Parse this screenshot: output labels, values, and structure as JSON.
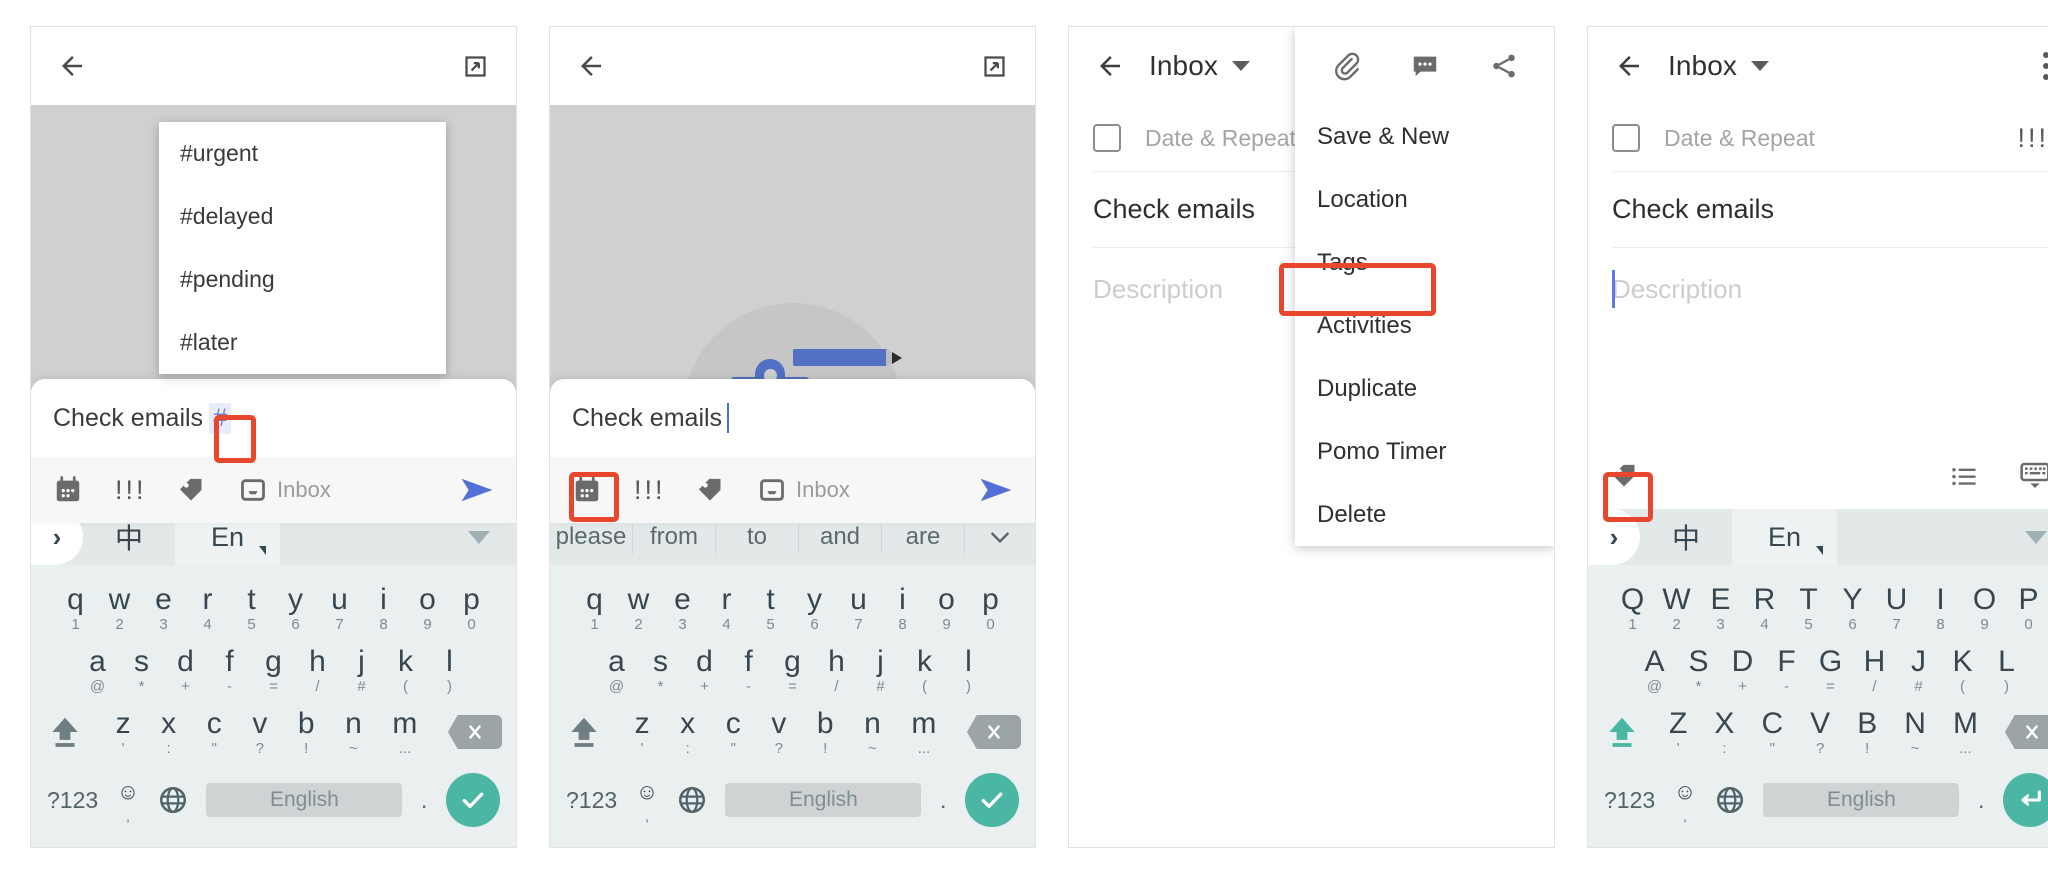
{
  "panels": [
    {
      "id": "panel-1-tag-autocomplete",
      "appbar": {
        "back_icon": "arrow-left-icon",
        "expand_icon": "open-in-new-icon"
      },
      "tag_suggestions": [
        "#urgent",
        "#delayed",
        "#pending",
        "#later"
      ],
      "compose": {
        "text": "Check emails",
        "token": "#",
        "tools": [
          "calendar-icon",
          "priority-icon",
          "tag-icon",
          "inbox-icon"
        ],
        "list_label": "Inbox",
        "send_icon": "send-icon"
      },
      "keyboard": {
        "lang_expand": "›",
        "lang_zh": "中",
        "lang_en": "En",
        "collapse_icon": "triangle-down-icon",
        "row1": [
          {
            "main": "q",
            "sub": "1"
          },
          {
            "main": "w",
            "sub": "2"
          },
          {
            "main": "e",
            "sub": "3"
          },
          {
            "main": "r",
            "sub": "4"
          },
          {
            "main": "t",
            "sub": "5"
          },
          {
            "main": "y",
            "sub": "6"
          },
          {
            "main": "u",
            "sub": "7"
          },
          {
            "main": "i",
            "sub": "8"
          },
          {
            "main": "o",
            "sub": "9"
          },
          {
            "main": "p",
            "sub": "0"
          }
        ],
        "row2": [
          {
            "main": "a",
            "sub": "@"
          },
          {
            "main": "s",
            "sub": "*"
          },
          {
            "main": "d",
            "sub": "+"
          },
          {
            "main": "f",
            "sub": "-"
          },
          {
            "main": "g",
            "sub": "="
          },
          {
            "main": "h",
            "sub": "/"
          },
          {
            "main": "j",
            "sub": "#"
          },
          {
            "main": "k",
            "sub": "("
          },
          {
            "main": "l",
            "sub": ")"
          }
        ],
        "row3": [
          {
            "main": "z",
            "sub": "'"
          },
          {
            "main": "x",
            "sub": ":"
          },
          {
            "main": "c",
            "sub": "\""
          },
          {
            "main": "v",
            "sub": "?"
          },
          {
            "main": "b",
            "sub": "!"
          },
          {
            "main": "n",
            "sub": "~"
          },
          {
            "main": "m",
            "sub": "..."
          }
        ],
        "shift_icon": "shift-icon",
        "backspace_icon": "backspace-icon",
        "numeric_key": "?123",
        "emoji_key": "☺",
        "emoji_sub": ",",
        "globe_icon": "globe-icon",
        "spacebar": "English",
        "period_key": ".",
        "action_icon": "check-icon",
        "shift_active": false
      }
    },
    {
      "id": "panel-2-date-picker-entry",
      "appbar": {
        "back_icon": "arrow-left-icon",
        "expand_icon": "open-in-new-icon"
      },
      "compose": {
        "text": "Check emails",
        "tools": [
          "calendar-icon",
          "priority-icon",
          "tag-icon",
          "inbox-icon"
        ],
        "list_label": "Inbox",
        "send_icon": "send-icon"
      },
      "suggestions": [
        "please",
        "from",
        "to",
        "and",
        "are"
      ],
      "suggestions_more_icon": "chevron-down-icon",
      "keyboard": {
        "row1": [
          {
            "main": "q",
            "sub": "1"
          },
          {
            "main": "w",
            "sub": "2"
          },
          {
            "main": "e",
            "sub": "3"
          },
          {
            "main": "r",
            "sub": "4"
          },
          {
            "main": "t",
            "sub": "5"
          },
          {
            "main": "y",
            "sub": "6"
          },
          {
            "main": "u",
            "sub": "7"
          },
          {
            "main": "i",
            "sub": "8"
          },
          {
            "main": "o",
            "sub": "9"
          },
          {
            "main": "p",
            "sub": "0"
          }
        ],
        "row2": [
          {
            "main": "a",
            "sub": "@"
          },
          {
            "main": "s",
            "sub": "*"
          },
          {
            "main": "d",
            "sub": "+"
          },
          {
            "main": "f",
            "sub": "-"
          },
          {
            "main": "g",
            "sub": "="
          },
          {
            "main": "h",
            "sub": "/"
          },
          {
            "main": "j",
            "sub": "#"
          },
          {
            "main": "k",
            "sub": "("
          },
          {
            "main": "l",
            "sub": ")"
          }
        ],
        "row3": [
          {
            "main": "z",
            "sub": "'"
          },
          {
            "main": "x",
            "sub": ":"
          },
          {
            "main": "c",
            "sub": "\""
          },
          {
            "main": "v",
            "sub": "?"
          },
          {
            "main": "b",
            "sub": "!"
          },
          {
            "main": "n",
            "sub": "~"
          },
          {
            "main": "m",
            "sub": "..."
          }
        ],
        "numeric_key": "?123",
        "emoji_key": "☺",
        "emoji_sub": ",",
        "spacebar": "English",
        "period_key": ".",
        "action_icon": "check-icon",
        "shift_active": false
      }
    },
    {
      "id": "panel-3-overflow-menu",
      "appbar": {
        "back_icon": "arrow-left-icon",
        "title": "Inbox",
        "caret": "caret-down-icon"
      },
      "form": {
        "checkbox": "task-checkbox",
        "date_label": "Date & Repeat",
        "task_title": "Check emails",
        "description_placeholder": "Description"
      },
      "menu": {
        "icons": [
          "attachment-icon",
          "comment-icon",
          "share-icon"
        ],
        "items": [
          "Save & New",
          "Location",
          "Tags",
          "Activities",
          "Duplicate",
          "Pomo Timer",
          "Delete"
        ],
        "highlighted": "Tags"
      }
    },
    {
      "id": "panel-4-description-focus",
      "appbar": {
        "back_icon": "arrow-left-icon",
        "title": "Inbox",
        "caret": "caret-down-icon",
        "overflow_icon": "more-vert-icon"
      },
      "form": {
        "checkbox": "task-checkbox",
        "date_label": "Date & Repeat",
        "priority": "!!!",
        "task_title": "Check emails",
        "description_placeholder": "Description"
      },
      "bottombar": {
        "tools": [
          "tag-icon"
        ],
        "right_tools": [
          "checklist-icon",
          "hide-keyboard-icon"
        ]
      },
      "keyboard": {
        "lang_expand": "›",
        "lang_zh": "中",
        "lang_en": "En",
        "collapse_icon": "triangle-down-icon",
        "row1": [
          {
            "main": "Q",
            "sub": "1"
          },
          {
            "main": "W",
            "sub": "2"
          },
          {
            "main": "E",
            "sub": "3"
          },
          {
            "main": "R",
            "sub": "4"
          },
          {
            "main": "T",
            "sub": "5"
          },
          {
            "main": "Y",
            "sub": "6"
          },
          {
            "main": "U",
            "sub": "7"
          },
          {
            "main": "I",
            "sub": "8"
          },
          {
            "main": "O",
            "sub": "9"
          },
          {
            "main": "P",
            "sub": "0"
          }
        ],
        "row2": [
          {
            "main": "A",
            "sub": "@"
          },
          {
            "main": "S",
            "sub": "*"
          },
          {
            "main": "D",
            "sub": "+"
          },
          {
            "main": "F",
            "sub": "-"
          },
          {
            "main": "G",
            "sub": "="
          },
          {
            "main": "H",
            "sub": "/"
          },
          {
            "main": "J",
            "sub": "#"
          },
          {
            "main": "K",
            "sub": "("
          },
          {
            "main": "L",
            "sub": ")"
          }
        ],
        "row3": [
          {
            "main": "Z",
            "sub": "'"
          },
          {
            "main": "X",
            "sub": ":"
          },
          {
            "main": "C",
            "sub": "\""
          },
          {
            "main": "V",
            "sub": "?"
          },
          {
            "main": "B",
            "sub": "!"
          },
          {
            "main": "N",
            "sub": "~"
          },
          {
            "main": "M",
            "sub": "..."
          }
        ],
        "shift_icon": "shift-icon",
        "backspace_icon": "backspace-icon",
        "numeric_key": "?123",
        "emoji_key": "☺",
        "emoji_sub": ",",
        "globe_icon": "globe-icon",
        "spacebar": "English",
        "period_key": ".",
        "action_icon": "enter-icon",
        "shift_active": true
      }
    }
  ],
  "colors": {
    "annotation": "#e8472d",
    "accent_blue": "#4a6fe0",
    "keyboard_action": "#4cb6a4",
    "canvas_grey": "#d0d0d0",
    "token_blue": "#6b7fd4"
  }
}
